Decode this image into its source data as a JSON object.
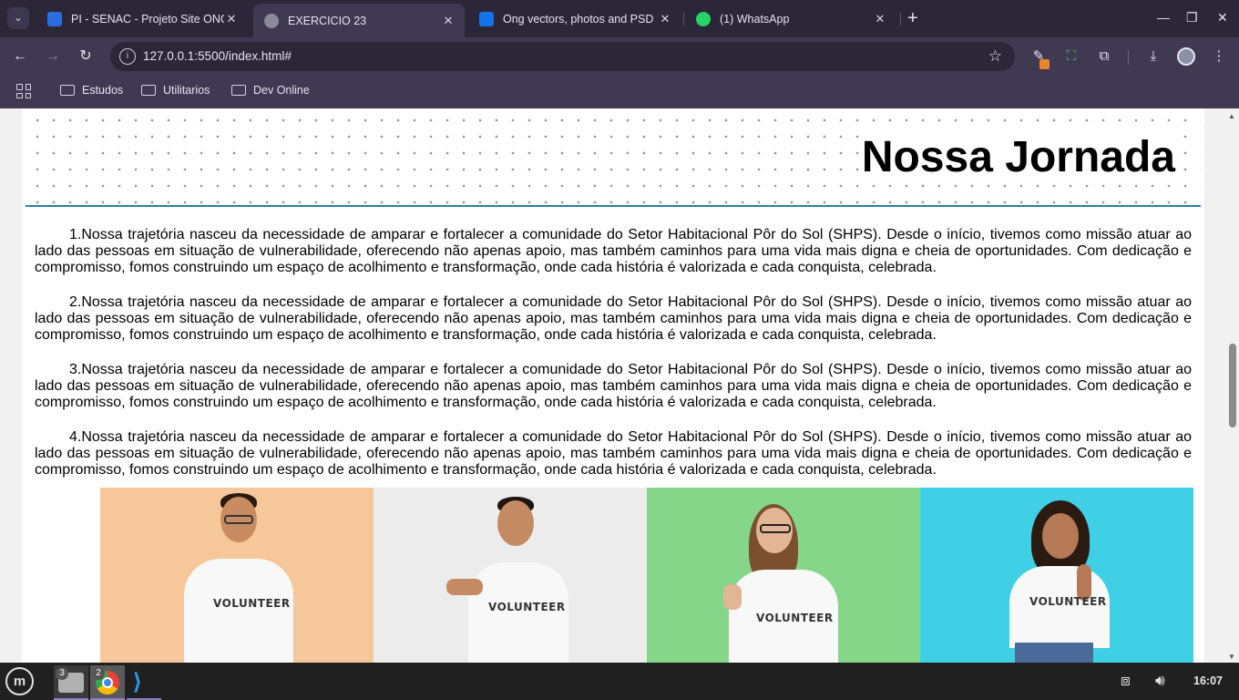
{
  "browser": {
    "tabs": [
      {
        "title": "PI - SENAC - Projeto Site ONG",
        "favicon_color": "#2b6de0",
        "active": false
      },
      {
        "title": "EXERCICIO 23",
        "favicon_color": "#8a8a9a",
        "active": true
      },
      {
        "title": "Ong vectors, photos and PSD",
        "favicon_color": "#1273eb",
        "active": false
      },
      {
        "title": "(1) WhatsApp",
        "favicon_color": "#25d366",
        "active": false
      }
    ],
    "tab_close_glyph": "✕",
    "new_tab_glyph": "+",
    "url": "127.0.0.1:5500/index.html#",
    "bookmarks": [
      "Estudos",
      "Utilitarios",
      "Dev Online"
    ]
  },
  "page": {
    "title": "Nossa Jornada",
    "paragraphs": [
      "1.Nossa trajetória nasceu da necessidade de amparar e fortalecer a comunidade do Setor Habitacional Pôr do Sol (SHPS). Desde o início, tivemos como missão atuar ao lado das pessoas em situação de vulnerabilidade, oferecendo não apenas apoio, mas também caminhos para uma vida mais digna e cheia de oportunidades. Com dedicação e compromisso, fomos construindo um espaço de acolhimento e transformação, onde cada história é valorizada e cada conquista, celebrada.",
      "2.Nossa trajetória nasceu da necessidade de amparar e fortalecer a comunidade do Setor Habitacional Pôr do Sol (SHPS). Desde o início, tivemos como missão atuar ao lado das pessoas em situação de vulnerabilidade, oferecendo não apenas apoio, mas também caminhos para uma vida mais digna e cheia de oportunidades. Com dedicação e compromisso, fomos construindo um espaço de acolhimento e transformação, onde cada história é valorizada e cada conquista, celebrada.",
      "3.Nossa trajetória nasceu da necessidade de amparar e fortalecer a comunidade do Setor Habitacional Pôr do Sol (SHPS). Desde o início, tivemos como missão atuar ao lado das pessoas em situação de vulnerabilidade, oferecendo não apenas apoio, mas também caminhos para uma vida mais digna e cheia de oportunidades. Com dedicação e compromisso, fomos construindo um espaço de acolhimento e transformação, onde cada história é valorizada e cada conquista, celebrada.",
      "4.Nossa trajetória nasceu da necessidade de amparar e fortalecer a comunidade do Setor Habitacional Pôr do Sol (SHPS). Desde o início, tivemos como missão atuar ao lado das pessoas em situação de vulnerabilidade, oferecendo não apenas apoio, mas também caminhos para uma vida mais digna e cheia de oportunidades. Com dedicação e compromisso, fomos construindo um espaço de acolhimento e transformação, onde cada história é valorizada e cada conquista, celebrada."
    ],
    "photos": [
      {
        "bg": "#f5c79a",
        "shirt_text": "VOLUNTEER",
        "hair": "#2b1a10",
        "skin": "#c98b62"
      },
      {
        "bg": "#ececec",
        "shirt_text": "VOLUNTEER",
        "hair": "#1e1510",
        "skin": "#c48a64"
      },
      {
        "bg": "#86d68a",
        "shirt_text": "VOLUNTEER",
        "hair": "#7a5030",
        "skin": "#e2b694"
      },
      {
        "bg": "#3fd0e6",
        "shirt_text": "VOLUNTEER",
        "hair": "#2a1a12",
        "skin": "#b57a55"
      }
    ]
  },
  "taskbar": {
    "apps": [
      {
        "name": "files",
        "badge": "3"
      },
      {
        "name": "chrome",
        "badge": "2"
      },
      {
        "name": "vscode",
        "badge": ""
      }
    ],
    "clock": "16:07"
  }
}
